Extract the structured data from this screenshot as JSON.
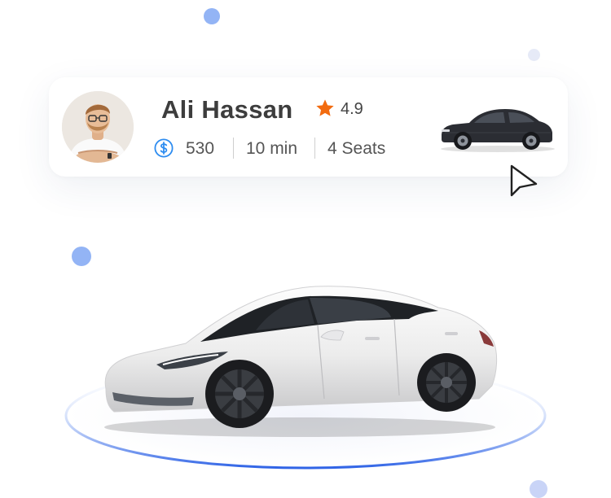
{
  "driver_card": {
    "name": "Ali Hassan",
    "rating": "4.9",
    "fare": "530",
    "duration": "10 min",
    "seats": "4 Seats"
  },
  "icons": {
    "star": "star-icon",
    "fare": "dollar-coin-icon",
    "cursor": "mouse-pointer-icon"
  },
  "colors": {
    "star": "#f26b0f",
    "fare_icon": "#2d8cf0",
    "accent_dots": "#93b4f5",
    "platform_ring": "#3a6ee8",
    "name_text": "#3d3d3d",
    "meta_text": "#555555"
  }
}
